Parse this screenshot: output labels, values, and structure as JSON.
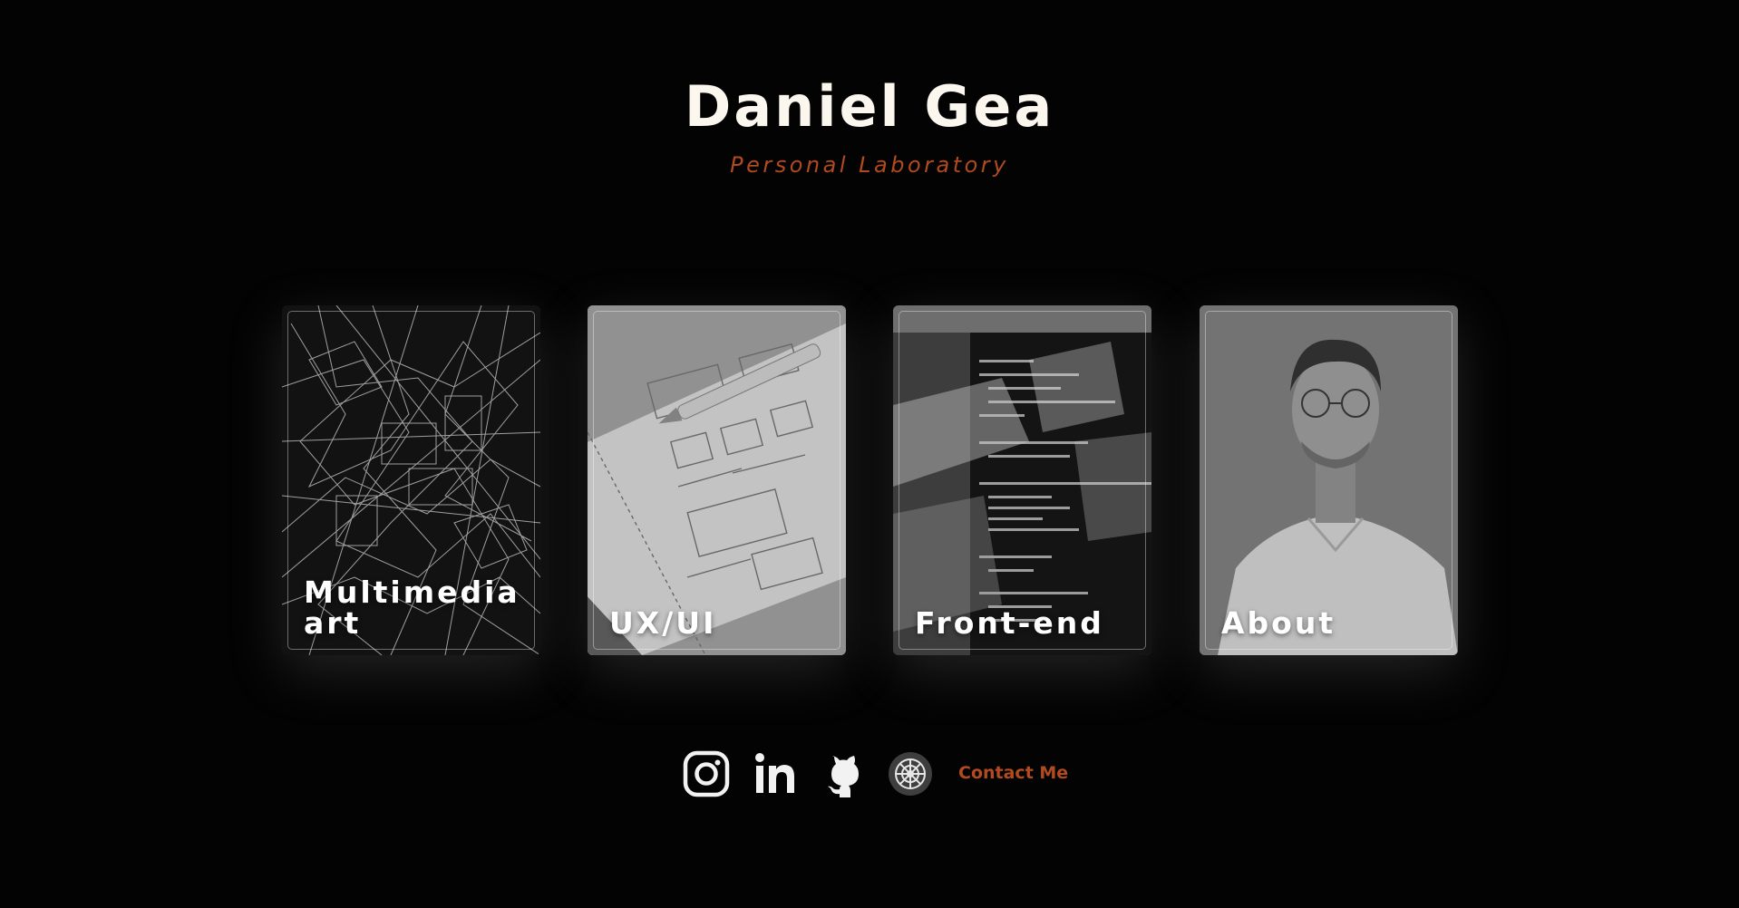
{
  "header": {
    "title": "Daniel Gea",
    "subtitle": "Personal Laboratory"
  },
  "cards": [
    {
      "label": "Multimedia art"
    },
    {
      "label": "UX/UI"
    },
    {
      "label": "Front-end"
    },
    {
      "label": "About"
    }
  ],
  "social": {
    "icons": [
      "instagram-icon",
      "linkedin-icon",
      "github-icon",
      "web-icon"
    ],
    "contact_label": "Contact Me"
  },
  "colors": {
    "background": "#030303",
    "title": "#fbf6ee",
    "accent": "#b24a1f"
  }
}
